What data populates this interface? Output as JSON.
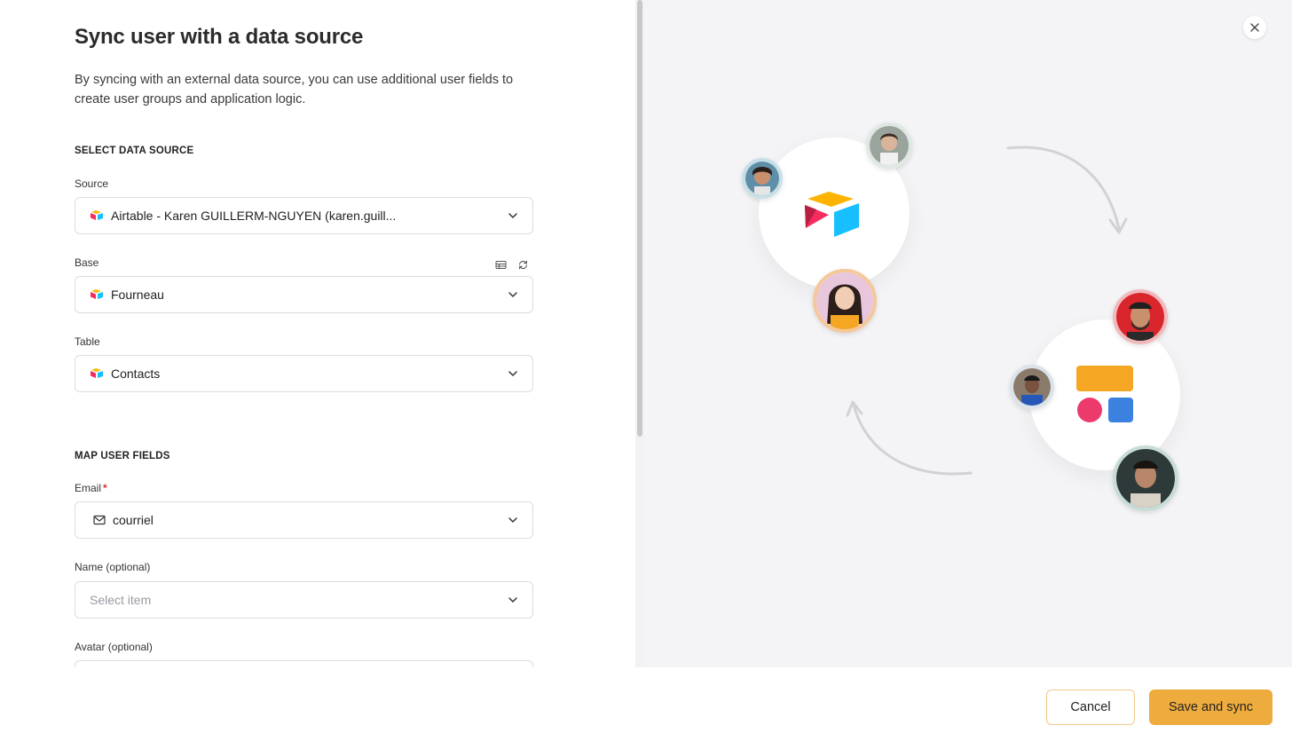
{
  "dialog": {
    "title": "Sync user with a data source",
    "description": "By syncing with an external data source, you can use additional user fields to create user groups and application logic."
  },
  "select_data_source": {
    "heading": "SELECT DATA SOURCE",
    "source": {
      "label": "Source",
      "value": "Airtable - Karen GUILLERM-NGUYEN (karen.guill..."
    },
    "base": {
      "label": "Base",
      "value": "Fourneau"
    },
    "table": {
      "label": "Table",
      "value": "Contacts"
    }
  },
  "map_user_fields": {
    "heading": "MAP USER FIELDS",
    "email": {
      "label": "Email",
      "required_mark": "*",
      "value": "courriel"
    },
    "name": {
      "label": "Name (optional)",
      "placeholder": "Select item"
    },
    "avatar": {
      "label": "Avatar (optional)"
    }
  },
  "footer": {
    "cancel_label": "Cancel",
    "save_label": "Save and sync"
  },
  "colors": {
    "accent": "#efac3e",
    "airtable_yellow": "#fcb400",
    "airtable_blue": "#18bfff",
    "airtable_red": "#f82b60",
    "app_orange": "#f5a623",
    "app_pink": "#ec3a6c",
    "app_blue": "#3b82e0"
  }
}
